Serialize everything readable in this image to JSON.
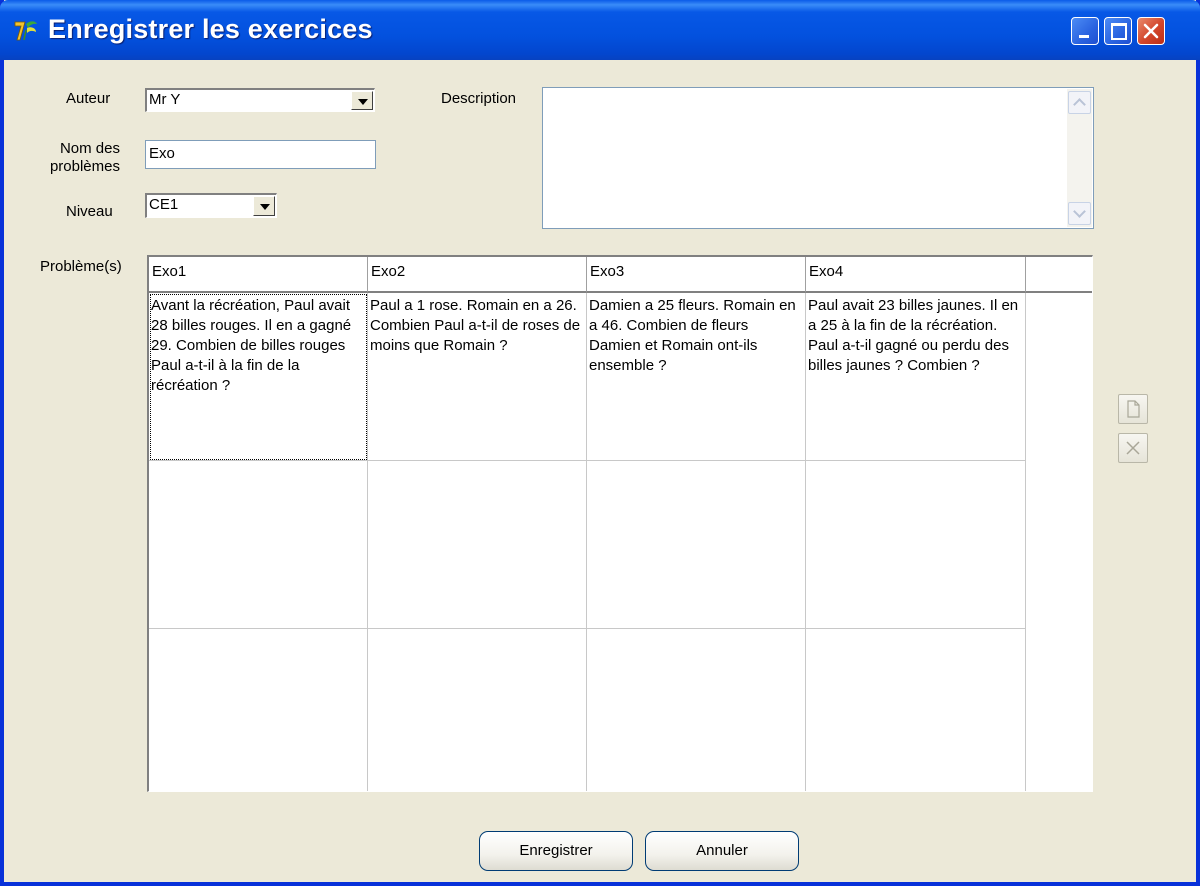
{
  "window": {
    "title": "Enregistrer les exercices",
    "buttons": [
      "minimize",
      "maximize",
      "close"
    ]
  },
  "form": {
    "author_label": "Auteur",
    "author_value": "Mr Y",
    "name_label_line1": "Nom des",
    "name_label_line2": "problèmes",
    "name_value": "Exo",
    "level_label": "Niveau",
    "level_value": "CE1",
    "description_label": "Description",
    "description_value": "",
    "problems_label": "Problème(s)"
  },
  "grid": {
    "headers": [
      "Exo1",
      "Exo2",
      "Exo3",
      "Exo4",
      ""
    ],
    "rows": [
      [
        "Avant la récréation, Paul avait 28 billes rouges. Il en a gagné 29. Combien de billes rouges Paul a-t-il à la fin de la récréation ?",
        "Paul a 1 rose. Romain en a 26. Combien Paul a-t-il de roses de moins que Romain ?",
        "Damien a 25 fleurs. Romain en a 46. Combien de fleurs Damien et Romain ont-ils ensemble ?",
        "Paul avait 23 billes jaunes. Il en a 25 à la fin de la récréation. Paul a-t-il gagné ou perdu des billes jaunes ? Combien ?"
      ],
      [
        "",
        "",
        "",
        ""
      ],
      [
        "",
        "",
        "",
        ""
      ]
    ]
  },
  "side_buttons": [
    "new-document-icon",
    "delete-icon"
  ],
  "actions": {
    "save_label": "Enregistrer",
    "cancel_label": "Annuler"
  },
  "colors": {
    "titlebar": "#0353E0",
    "window_bg": "#ECE9D8",
    "close_button": "#D2452A"
  }
}
